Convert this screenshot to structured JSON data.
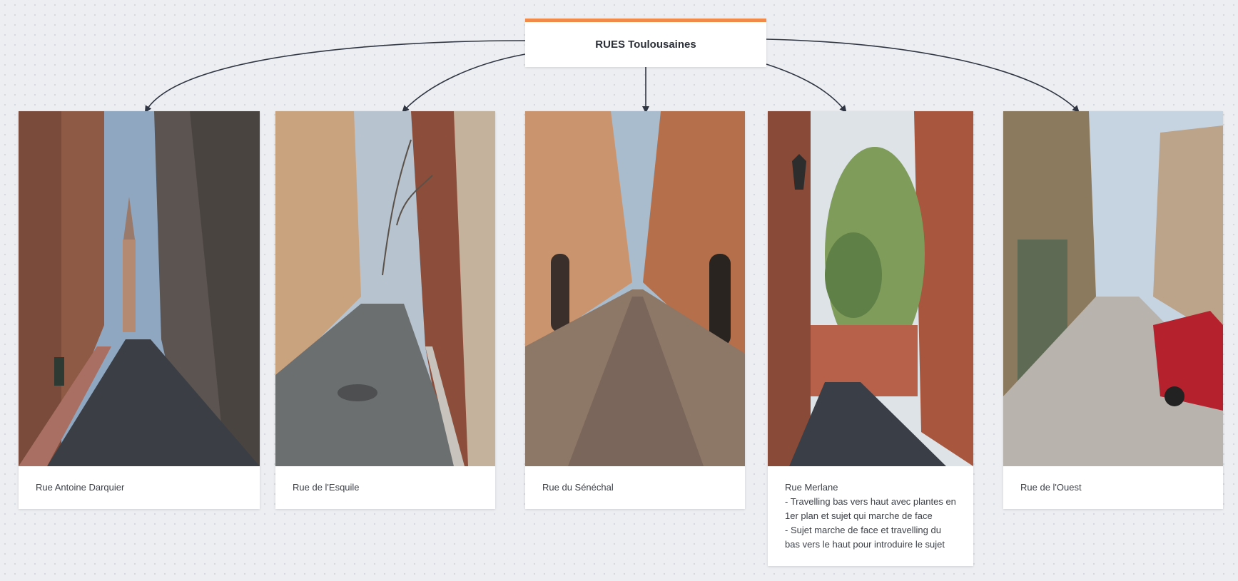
{
  "board": {
    "title": "RUES Toulousaines",
    "accent_color": "#f08a4b",
    "connector_color": "#2f3542"
  },
  "cards": [
    {
      "image": "street-photo-rue-antoine-darquier",
      "caption": [
        "Rue Antoine Darquier"
      ]
    },
    {
      "image": "street-photo-rue-de-l-esquile",
      "caption": [
        "Rue de l'Esquile"
      ]
    },
    {
      "image": "street-photo-rue-du-senechal",
      "caption": [
        "Rue du Sénéchal"
      ]
    },
    {
      "image": "street-photo-rue-merlane",
      "caption": [
        "Rue Merlane",
        "- Travelling bas vers haut avec plantes en",
        "1er plan et sujet qui marche de face",
        "- Sujet marche de face et travelling du",
        "bas vers le haut pour introduire le sujet"
      ]
    },
    {
      "image": "street-photo-rue-de-l-ouest",
      "caption": [
        "Rue de l'Ouest"
      ]
    }
  ]
}
